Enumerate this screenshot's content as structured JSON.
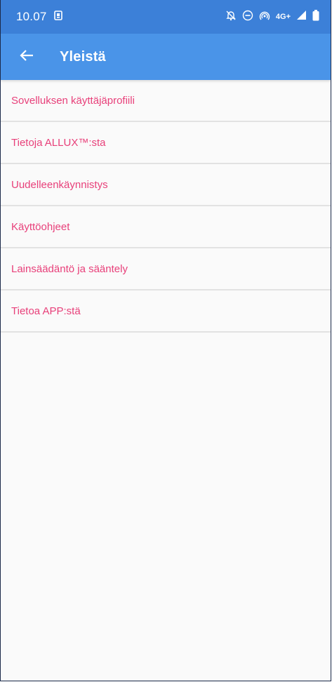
{
  "status_bar": {
    "time": "10.07",
    "network": "4G+",
    "icons": [
      "screenshot-notification-icon",
      "alarm-off-icon",
      "do-not-disturb-icon",
      "hotspot-icon",
      "signal-icon",
      "battery-icon"
    ]
  },
  "app_bar": {
    "back_icon": "arrow-left-icon",
    "title": "Yleistä"
  },
  "menu": {
    "items": [
      {
        "label": "Sovelluksen käyttäjäprofiili"
      },
      {
        "label": "Tietoja ALLUX™:sta"
      },
      {
        "label": "Uudelleenkäynnistys"
      },
      {
        "label": "Käyttöohjeet"
      },
      {
        "label": "Lainsäädäntö ja sääntely"
      },
      {
        "label": "Tietoa APP:stä"
      }
    ]
  },
  "colors": {
    "status_bar": "#3c80d8",
    "app_bar": "#4a94e8",
    "menu_text": "#e8407a",
    "divider": "#e2e2e2",
    "background": "#fafafa"
  }
}
